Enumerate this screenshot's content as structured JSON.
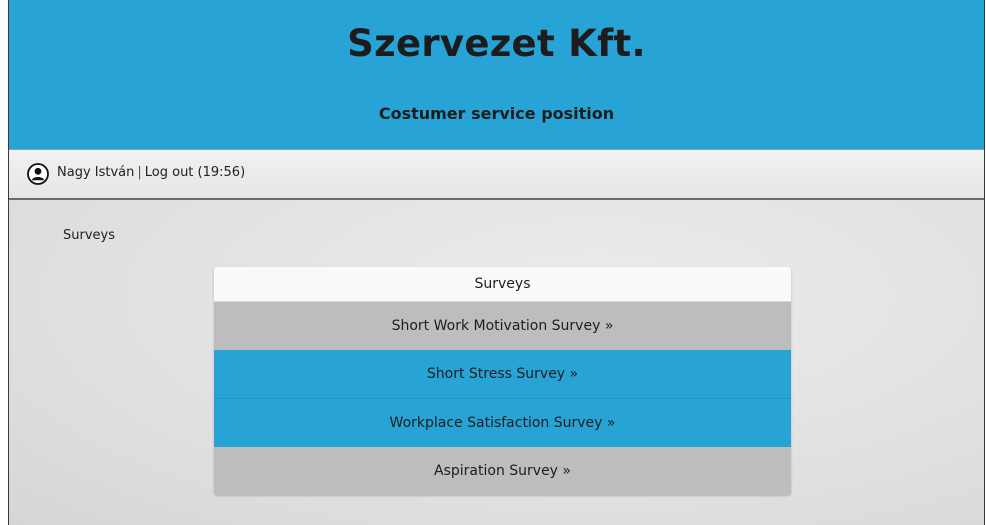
{
  "header": {
    "company": "Szervezet Kft.",
    "position": "Costumer service position",
    "accent_color": "#27a3d6"
  },
  "userbar": {
    "icon": "user-icon",
    "user_name": "Nagy István",
    "separator": "|",
    "logout_label": "Log out (19:56)"
  },
  "breadcrumb": "Surveys",
  "surveys_panel": {
    "title": "Surveys",
    "items": [
      {
        "label": "Short Work Motivation Survey »",
        "style": "gray"
      },
      {
        "label": "Short Stress Survey »",
        "style": "blue"
      },
      {
        "label": "Workplace Satisfaction Survey »",
        "style": "blue"
      },
      {
        "label": "Aspiration Survey »",
        "style": "gray"
      }
    ]
  }
}
